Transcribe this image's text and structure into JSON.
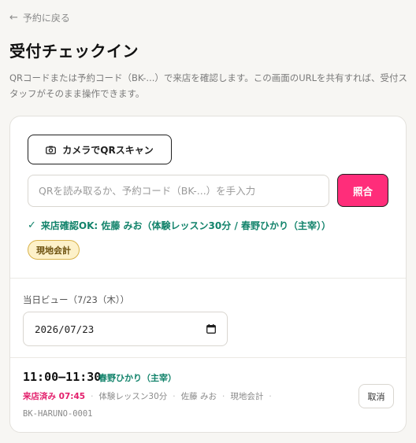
{
  "nav": {
    "back_label": "予約に戻る"
  },
  "page": {
    "title": "受付チェックイン",
    "description": "QRコードまたは予約コード（BK-...）で来店を確認します。この画面のURLを共有すれば、受付スタッフがそのまま操作できます。"
  },
  "scan": {
    "camera_button_label": "カメラでQRスキャン"
  },
  "lookup": {
    "input_value": "",
    "input_placeholder": "QRを読み取るか、予約コード（BK-...）を手入力",
    "verify_button_label": "照合"
  },
  "result": {
    "status_text": "来店確認OK: 佐藤 みお（体験レッスン30分 / 春野ひかり（主宰））",
    "status_color": "#12836b",
    "payment_badge": "現地会計"
  },
  "day_view": {
    "label": "当日ビュー（7/23（木））",
    "date_value": "2026/07/23"
  },
  "bookings": [
    {
      "time": "11:00–11:30",
      "staff": "春野ひかり（主宰）",
      "checked_in": "来店済み 07:45",
      "service": "体験レッスン30分",
      "customer": "佐藤 みお",
      "payment": "現地会計",
      "code": "BK-HARUNO-0001",
      "cancel_label": "取消"
    }
  ],
  "colors": {
    "accent": "#ff2d7a",
    "success": "#12836b",
    "checked_in": "#e3206c",
    "badge_bg": "#fdf1c9"
  },
  "icons": {
    "back": "arrow-left-icon",
    "camera": "camera-icon",
    "check": "check-icon",
    "calendar": "calendar-icon"
  }
}
